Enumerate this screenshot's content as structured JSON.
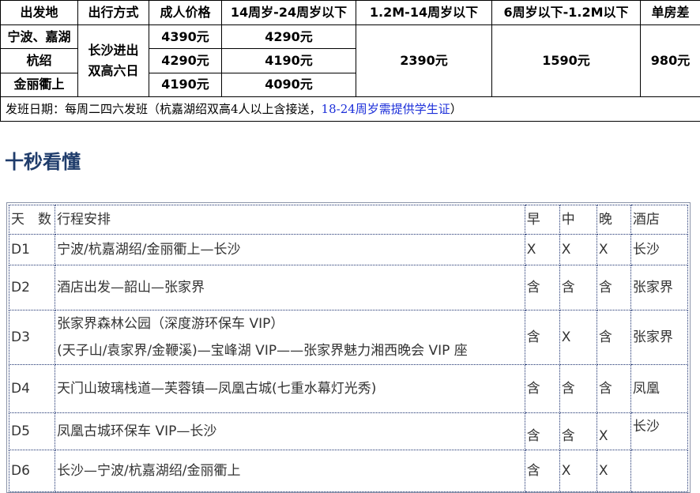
{
  "price_table": {
    "headers": [
      "出发地",
      "出行方式",
      "成人价格",
      "14周岁-24周岁以下",
      "1.2M-14周岁以下",
      "6周岁以下-1.2M以下",
      "单房差"
    ],
    "departures": [
      "宁波、嘉湖",
      "杭绍",
      "金丽衢上"
    ],
    "travel_mode_line1": "长沙进出",
    "travel_mode_line2": "双高六日",
    "adult_prices": [
      "4390元",
      "4290元",
      "4190元"
    ],
    "youth_prices": [
      "4290元",
      "4190元",
      "4090元"
    ],
    "child_price": "2390元",
    "infant_price": "1590元",
    "single_supplement": "980元",
    "note_prefix": "发班日期：每周二四六发班（杭嘉湖绍双高4人以上含接送，",
    "note_highlight": "18-24周岁需提供学生证",
    "note_suffix": "）"
  },
  "section_title": "十秒看懂",
  "itinerary": {
    "headers": [
      "天　数",
      "行程安排",
      "早",
      "中",
      "晚",
      "酒店"
    ],
    "days": [
      {
        "day": "D1",
        "line1": "宁波/杭嘉湖绍/金丽衢上—长沙",
        "line2": "",
        "breakfast": "X",
        "lunch": "X",
        "dinner": "X",
        "hotel": "长沙"
      },
      {
        "day": "D2",
        "line1": "酒店出发—韶山—张家界",
        "line2": "",
        "breakfast": "含",
        "lunch": "含",
        "dinner": "含",
        "hotel": "张家界"
      },
      {
        "day": "D3",
        "line1": "张家界森林公园（深度游环保车 VIP）",
        "line2": "(天子山/袁家界/金鞭溪)—宝峰湖 VIP——张家界魅力湘西晚会 VIP 座",
        "breakfast": "含",
        "lunch": "X",
        "dinner": "含",
        "hotel": "张家界"
      },
      {
        "day": "D4",
        "line1": "天门山玻璃栈道—芙蓉镇—凤凰古城(七重水幕灯光秀)",
        "line2": "",
        "breakfast": "含",
        "lunch": "含",
        "dinner": "含",
        "hotel": "凤凰"
      },
      {
        "day": "D5",
        "line1": "凤凰古城环保车 VIP—长沙",
        "line2": "",
        "breakfast": "含",
        "lunch": "含",
        "dinner": "X",
        "hotel": "长沙"
      },
      {
        "day": "D6",
        "line1": "长沙—宁波/杭嘉湖绍/金丽衢上",
        "line2": "",
        "breakfast": "含",
        "lunch": "X",
        "dinner": "X",
        "hotel": ""
      }
    ]
  }
}
